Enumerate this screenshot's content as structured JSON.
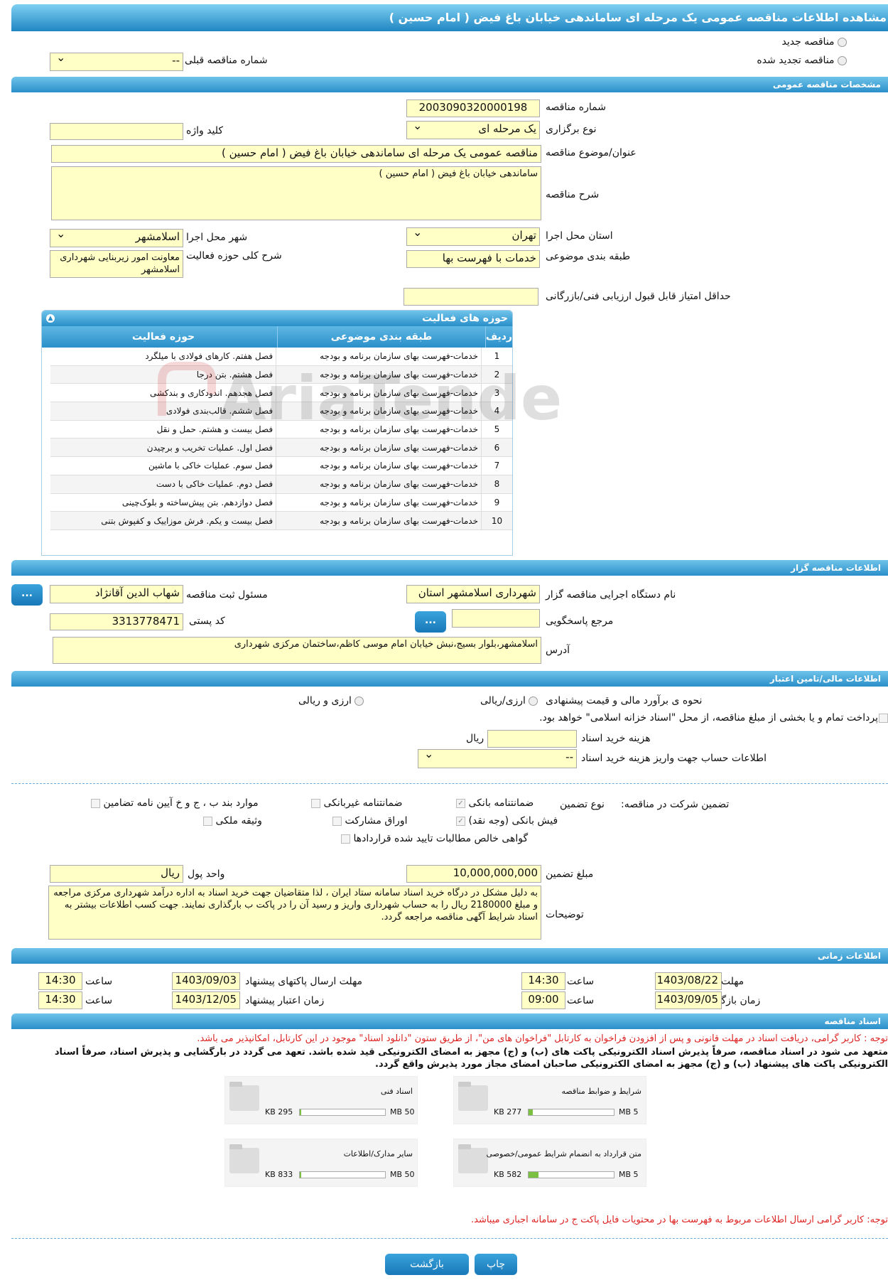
{
  "page_title": "مشاهده اطلاعات مناقصه عمومی یک مرحله ای ساماندهی خیابان باغ فیض ( امام حسین )",
  "top": {
    "new_tender": "مناقصه جدید",
    "renewed_tender": "مناقصه تجدید شده",
    "prev_tender_label": "شماره مناقصه قبلی",
    "prev_tender_value": "--"
  },
  "general": {
    "header": "مشخصات مناقصه عمومی",
    "tender_number_label": "شماره مناقصه",
    "tender_number": "2003090320000198",
    "type_label": "نوع برگزاری",
    "type_value": "یک مرحله ای",
    "keyword_label": "کلید واژه",
    "keyword_value": "",
    "title_label": "عنوان/موضوع مناقصه",
    "title_value": "مناقصه عمومی یک مرحله ای ساماندهی خیابان باغ فیض ( امام حسین )",
    "desc_label": "شرح مناقصه",
    "desc_value": "ساماندهی خیابان باغ فیض ( امام حسین )",
    "province_label": "استان محل اجرا",
    "province_value": "تهران",
    "city_label": "شهر محل اجرا",
    "city_value": "اسلامشهر",
    "category_label": "طبقه بندی موضوعی",
    "category_value": "خدمات با فهرست بها",
    "activity_desc_label": "شرح کلی حوزه فعالیت",
    "activity_desc_value": "معاونت امور زیربنایی شهرداری اسلامشهر",
    "min_score_label": "حداقل امتیاز قابل قبول ارزیابی فنی/بازرگانی",
    "min_score_value": ""
  },
  "activities": {
    "header": "حوزه های فعالیت",
    "columns": [
      "ردیف",
      "طبقه بندی موضوعی",
      "حوزه فعالیت"
    ],
    "rows": [
      [
        "1",
        "خدمات-فهرست بهای سازمان برنامه و بودجه",
        "فصل هفتم. کارهای فولادی با میلگرد"
      ],
      [
        "2",
        "خدمات-فهرست بهای سازمان برنامه و بودجه",
        "فصل هشتم. بتن درجا"
      ],
      [
        "3",
        "خدمات-فهرست بهای سازمان برنامه و بودجه",
        "فصل هجدهم. اندودکاری و بندکشی"
      ],
      [
        "4",
        "خدمات-فهرست بهای سازمان برنامه و بودجه",
        "فصل ششم. قالب‌بندی فولادی"
      ],
      [
        "5",
        "خدمات-فهرست بهای سازمان برنامه و بودجه",
        "فصل بیست و هشتم. حمل و نقل"
      ],
      [
        "6",
        "خدمات-فهرست بهای سازمان برنامه و بودجه",
        "فصل اول. عملیات تخریب و برچیدن"
      ],
      [
        "7",
        "خدمات-فهرست بهای سازمان برنامه و بودجه",
        "فصل سوم. عملیات خاکی با ماشین"
      ],
      [
        "8",
        "خدمات-فهرست بهای سازمان برنامه و بودجه",
        "فصل دوم. عملیات خاکی با دست"
      ],
      [
        "9",
        "خدمات-فهرست بهای سازمان برنامه و بودجه",
        "فصل دوازدهم. بتن پیش‌ساخته و بلوک‌چینی"
      ],
      [
        "10",
        "خدمات-فهرست بهای سازمان برنامه و بودجه",
        "فصل بیست و یکم. فرش موزاییک و کفپوش بتنی"
      ]
    ]
  },
  "organizer": {
    "header": "اطلاعات مناقصه گزار",
    "org_label": "نام دستگاه اجرایی مناقصه گزار",
    "org_value": "شهرداری اسلامشهر استان",
    "resp_label": "مسئول ثبت مناقصه",
    "resp_value": "شهاب الدین آقانژاد",
    "ref_label": "مرجع پاسخگویی",
    "ref_value": "",
    "postal_label": "کد پستی",
    "postal_value": "3313778471",
    "address_label": "آدرس",
    "address_value": "اسلامشهر،بلوار بسیج،نبش خیابان امام موسی کاظم،ساختمان مرکزی شهرداری",
    "dots": "..."
  },
  "finance": {
    "header": "اطلاعات مالی/تامین اعتبار",
    "estimate_label": "نحوه ی برآورد مالی و قیمت پیشنهادی",
    "opt_rial": "ارزی/ریالی",
    "opt_fx": "ارزی و ریالی",
    "treasury_text": "پرداخت تمام و یا بخشی از مبلغ مناقصه، از محل \"اسناد خزانه اسلامی\" خواهد بود.",
    "doc_cost_label": "هزینه خرید اسناد",
    "doc_cost_unit": "ریال",
    "doc_cost_value": "",
    "account_label": "اطلاعات حساب جهت واریز هزینه خرید اسناد",
    "account_value": "--"
  },
  "guarantee": {
    "label": "تضمین شرکت در مناقصه:",
    "type_label": "نوع تضمین",
    "items": [
      "ضمانتنامه بانکی",
      "ضمانتنامه غیربانکی",
      "موارد بند ب ، ج و خ آیین نامه تضامین",
      "فیش بانکی (وجه نقد)",
      "اوراق مشارکت",
      "وثیقه ملکی",
      "گواهی خالص مطالبات تایید شده قراردادها"
    ],
    "amount_label": "مبلغ تضمین",
    "amount_value": "10,000,000,000",
    "currency_label": "واحد پول",
    "currency_value": "ریال",
    "notes_label": "توضیحات",
    "notes_value": "به دلیل مشکل در درگاه خرید اسناد سامانه ستاد ایران ، لذا متقاضیان جهت خرید اسناد به اداره درآمد شهرداری مرکزی مراجعه و مبلغ 2180000 ریال را به حساب شهرداری واریز و رسید آن را در پاکت ب بارگذاری نمایند. جهت کسب اطلاعات بیشتر به اسناد شرایط آگهی مناقصه مراجعه گردد."
  },
  "timing": {
    "header": "اطلاعات زمانی",
    "receive_deadline_label": "مهلت دریافت اسناد",
    "receive_deadline": "1403/08/22",
    "time_label": "ساعت",
    "receive_time": "14:30",
    "submit_deadline_label": "مهلت ارسال پاکتهای پیشنهاد",
    "submit_deadline": "1403/09/03",
    "submit_time": "14:30",
    "opening_label": "زمان بازگشایی پاکت ها",
    "opening_date": "1403/09/05",
    "opening_time": "09:00",
    "validity_label": "زمان اعتبار پیشنهاد",
    "validity_date": "1403/12/05",
    "validity_time": "14:30"
  },
  "docs": {
    "header": "اسناد مناقصه",
    "notice_red": "توجه : کاربر گرامی، دریافت اسناد در مهلت قانونی و پس از افزودن فراخوان به کارتابل \"فراخوان های من\"، از طریق ستون \"دانلود اسناد\" موجود در این کارتابل، امکانپذیر می باشد.",
    "notice_bold": "متعهد می شود در اسناد مناقصه، صرفاً پذیرش اسناد الکترونیکی پاکت های (ب) و (ج) مجهز به امضای الکترونیکی قید شده باشد. تعهد می گردد در بارگشایی و پذیرش اسناد، صرفاً اسناد الکترونیکی پاکت های پیشنهاد (ب) و (ج) مجهز به امضای الکترونیکی صاحبان امضای مجاز مورد پذیرش واقع گردد.",
    "files": [
      {
        "name": "شرایط و ضوابط مناقصه",
        "size": "277 KB",
        "max": "5 MB",
        "fill": 0.05
      },
      {
        "name": "اسناد فنی",
        "size": "295 KB",
        "max": "50 MB",
        "fill": 0.01
      },
      {
        "name": "متن قرارداد به انضمام شرایط عمومی/خصوصی",
        "size": "582 KB",
        "max": "5 MB",
        "fill": 0.12
      },
      {
        "name": "سایر مدارک/اطلاعات",
        "size": "833 KB",
        "max": "50 MB",
        "fill": 0.02
      }
    ],
    "notice_red2": "توجه: کاربر گرامی ارسال اطلاعات مربوط به فهرست بها در محتویات فایل پاکت ج در سامانه اجباری میباشد."
  },
  "buttons": {
    "print": "چاپ",
    "back": "بازگشت"
  },
  "watermark": "AriaTender.neT"
}
